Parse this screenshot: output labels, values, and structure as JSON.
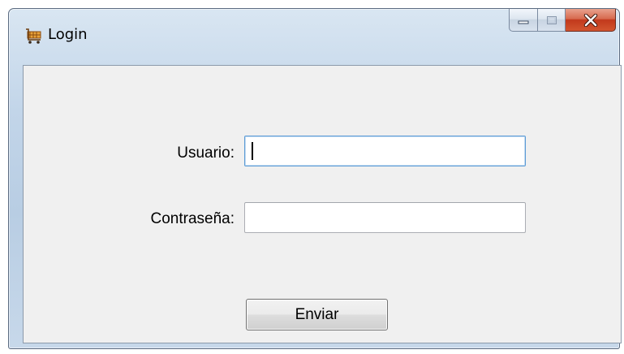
{
  "window": {
    "title": "Login",
    "icon": "shopping-cart-icon",
    "controls": {
      "minimize_icon": "minimize-icon",
      "maximize_icon": "maximize-icon",
      "close_icon": "close-icon"
    }
  },
  "form": {
    "username_label": "Usuario:",
    "username_value": "",
    "password_label": "Contraseña:",
    "password_value": "",
    "submit_label": "Enviar"
  },
  "colors": {
    "close_button": "#c7422a",
    "focus_border": "#5b9bd5",
    "client_background": "#f0f0f0"
  }
}
